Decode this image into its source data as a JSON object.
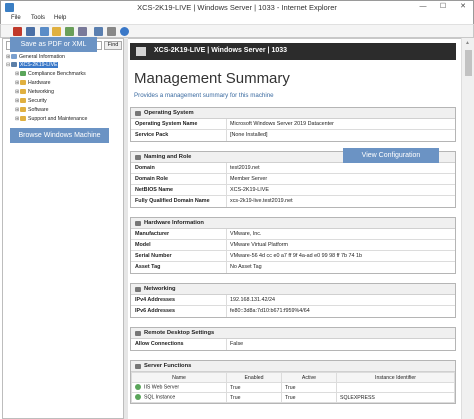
{
  "window": {
    "title": "XCS-2K19-LIVE | Windows Server | 1033 - Internet Explorer",
    "controls": {
      "minimize": "—",
      "maximize": "☐",
      "close": "✕"
    }
  },
  "menu": {
    "file": "File",
    "tools": "Tools",
    "help": "Help"
  },
  "toolbar": {
    "icons": [
      "stop-icon",
      "save-icon",
      "refresh-icon",
      "open-icon",
      "run-icon",
      "export-icon",
      "settings-icon",
      "print-icon",
      "help-icon"
    ]
  },
  "search": {
    "value": "",
    "find_label": "Find"
  },
  "tooltips": {
    "save_pdf": "Save as PDF or XML",
    "browse": "Browse Windows Machine",
    "view_config": "View Configuration"
  },
  "tree": {
    "items": [
      {
        "label": "General Information"
      },
      {
        "label": "XCS-2K19-LIVE"
      },
      {
        "label": "Compliance Benchmarks"
      },
      {
        "label": "Hardware"
      },
      {
        "label": "Networking"
      },
      {
        "label": "Security"
      },
      {
        "label": "Software"
      },
      {
        "label": "Support and Maintenance"
      }
    ]
  },
  "content": {
    "banner": "XCS-2K19-LIVE | Windows Server | 1033",
    "title": "Management Summary",
    "subtitle": "Provides a management summary for this machine",
    "sections": {
      "os": {
        "title": "Operating System",
        "rows": [
          {
            "k": "Operating System Name",
            "v": "Microsoft Windows Server 2019 Datacenter"
          },
          {
            "k": "Service Pack",
            "v": "[None Installed]"
          }
        ]
      },
      "naming": {
        "title": "Naming and Role",
        "rows": [
          {
            "k": "Domain",
            "v": "test2019.net"
          },
          {
            "k": "Domain Role",
            "v": "Member Server"
          },
          {
            "k": "NetBIOS Name",
            "v": "XCS-2K19-LIVE"
          },
          {
            "k": "Fully Qualified Domain Name",
            "v": "xcs-2k19-live.test2019.net"
          }
        ]
      },
      "hardware": {
        "title": "Hardware Information",
        "rows": [
          {
            "k": "Manufacturer",
            "v": "VMware, Inc."
          },
          {
            "k": "Model",
            "v": "VMware Virtual Platform"
          },
          {
            "k": "Serial Number",
            "v": "VMware-56 4d cc e0 a7 ff 9f 4a-ad e0 99 98 ff 7b 74 1b"
          },
          {
            "k": "Asset Tag",
            "v": "No Asset Tag"
          }
        ]
      },
      "networking": {
        "title": "Networking",
        "rows": [
          {
            "k": "IPv4 Addresses",
            "v": "192.168.131.42/24"
          },
          {
            "k": "IPv6 Addresses",
            "v": "fe80::3d8a:7d10:b671:f959%4/64"
          }
        ]
      },
      "rds": {
        "title": "Remote Desktop Settings",
        "rows": [
          {
            "k": "Allow Connections",
            "v": "False"
          }
        ]
      },
      "server_functions": {
        "title": "Server Functions",
        "headers": [
          "Name",
          "Enabled",
          "Active",
          "Instance Identifier"
        ],
        "rows": [
          [
            "IIS Web Server",
            "True",
            "True",
            ""
          ],
          [
            "SQL Instance",
            "True",
            "True",
            "SQLEXPRESS"
          ]
        ]
      }
    }
  },
  "colors": {
    "accent": "#3a78c8",
    "tooltip": "#6b93c4",
    "banner": "#2c2c2c",
    "link": "#3a6aa0"
  }
}
